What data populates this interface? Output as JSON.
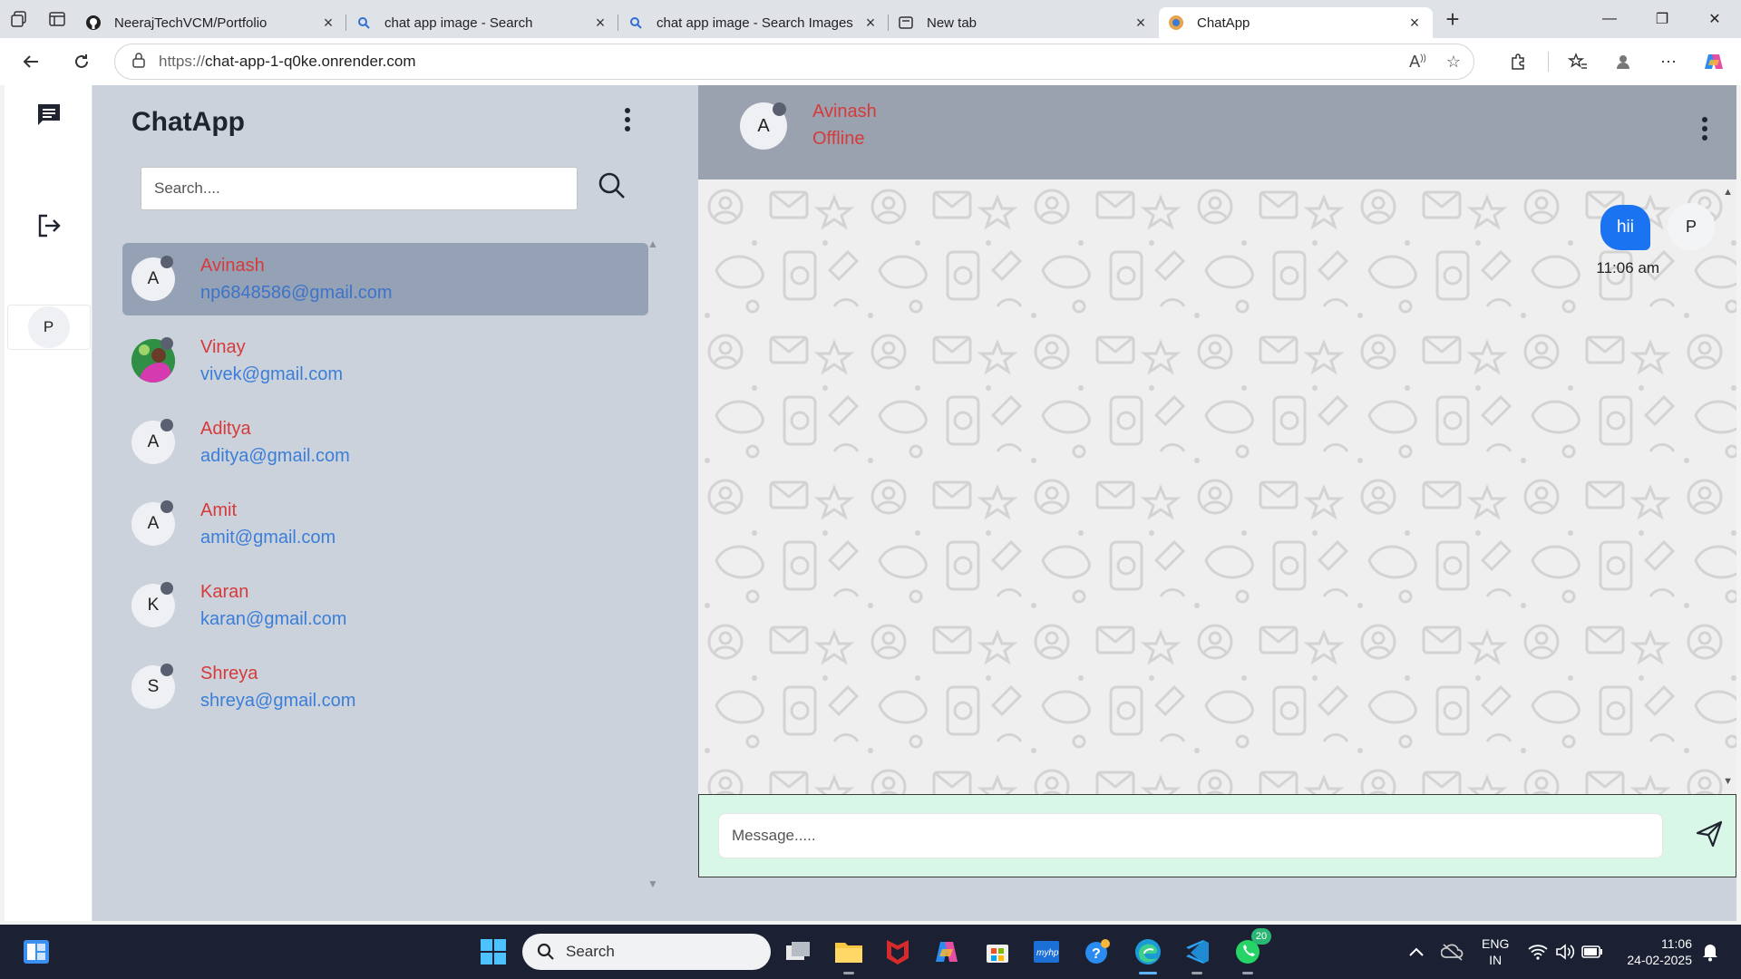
{
  "browser": {
    "tabs": [
      {
        "title": "NeerajTechVCM/Portfolio",
        "icon": "github-icon"
      },
      {
        "title": "chat app image - Search",
        "icon": "search-icon"
      },
      {
        "title": "chat app image - Search Images",
        "icon": "search-icon"
      },
      {
        "title": "New tab",
        "icon": "newtab-icon"
      },
      {
        "title": "ChatApp",
        "icon": "chatapp-icon"
      }
    ],
    "url_protocol": "https://",
    "url_host": "chat-app-1-q0ke.onrender.com"
  },
  "rail": {
    "user_initial": "P"
  },
  "sidebar": {
    "title": "ChatApp",
    "search_placeholder": "Search....",
    "contacts": [
      {
        "name": "Avinash",
        "email": "np6848586@gmail.com",
        "initial": "A",
        "selected": true
      },
      {
        "name": "Vinay",
        "email": "vivek@gmail.com",
        "initial": "",
        "photo": true
      },
      {
        "name": "Aditya",
        "email": "aditya@gmail.com",
        "initial": "A"
      },
      {
        "name": "Amit",
        "email": "amit@gmail.com",
        "initial": "A"
      },
      {
        "name": "Karan",
        "email": "karan@gmail.com",
        "initial": "K"
      },
      {
        "name": "Shreya",
        "email": "shreya@gmail.com",
        "initial": "S"
      }
    ]
  },
  "chat": {
    "contact_initial": "A",
    "contact_name": "Avinash",
    "contact_status": "Offline",
    "messages": [
      {
        "text": "hii",
        "time": "11:06 am",
        "sender_initial": "P"
      }
    ],
    "composer_placeholder": "Message....."
  },
  "taskbar": {
    "search_label": "Search",
    "whatsapp_badge": "20",
    "lang_line1": "ENG",
    "lang_line2": "IN",
    "time": "11:06",
    "date": "24-02-2025"
  },
  "colors": {
    "sidebar_bg": "#cbd2dc",
    "selected_item": "#95a2b6",
    "name_red": "#d63a3a",
    "email_blue": "#3b7ed8",
    "bubble_blue": "#1a73f0",
    "composer_bg": "#d9f7e6",
    "chat_header_bg": "#9aa2af"
  }
}
